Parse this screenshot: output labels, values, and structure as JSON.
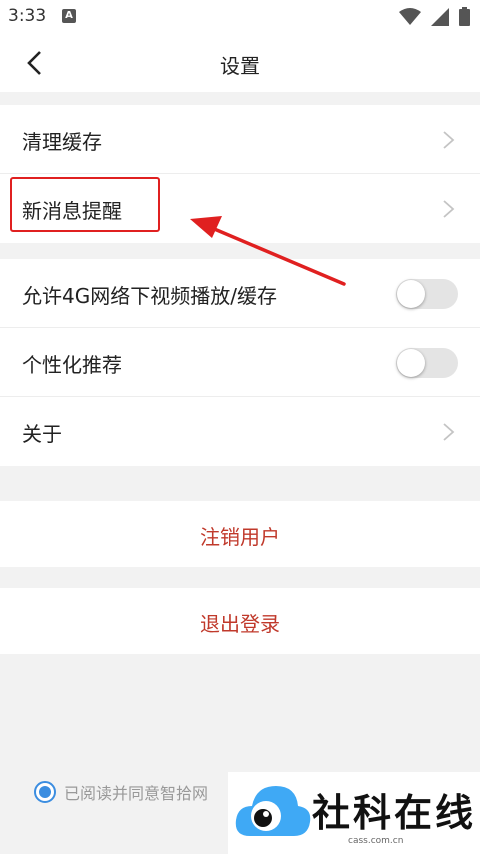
{
  "status_bar": {
    "time": "3:33",
    "notification_badge": "A",
    "icons": [
      "wifi-icon",
      "signal-icon",
      "battery-icon"
    ]
  },
  "nav": {
    "title": "设置",
    "back_icon": "back-arrow-icon"
  },
  "sections": {
    "group1": [
      {
        "label": "清理缓存",
        "type": "link"
      },
      {
        "label": "新消息提醒",
        "type": "link"
      }
    ],
    "group2": [
      {
        "label": "允许4G网络下视频播放/缓存",
        "type": "toggle",
        "on": false
      },
      {
        "label": "个性化推荐",
        "type": "toggle",
        "on": false
      },
      {
        "label": "关于",
        "type": "link"
      }
    ]
  },
  "actions": {
    "deregister_label": "注销用户",
    "logout_label": "退出登录"
  },
  "agreement": {
    "text": "已阅读并同意智拾网",
    "checked": true
  },
  "watermark": {
    "text": "社科在线",
    "sub": "cass.com.cn"
  },
  "colors": {
    "accent_red": "#c0392b",
    "annotation_red": "#e02020",
    "radio_blue": "#3b8de0",
    "logo_blue": "#3fa9f5"
  }
}
